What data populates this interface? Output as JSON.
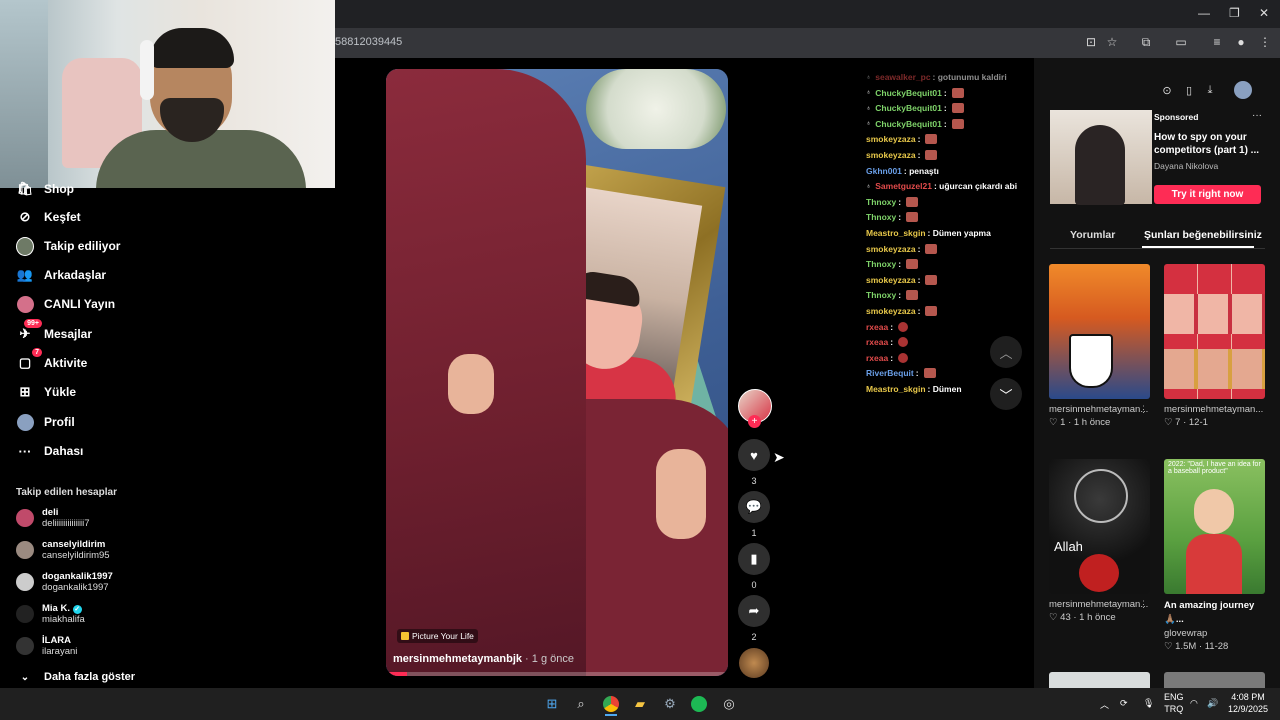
{
  "browser": {
    "url_fragment": "58812039445"
  },
  "sidebar": {
    "items": [
      {
        "label": "Shop",
        "icon": "shop-icon"
      },
      {
        "label": "Keşfet",
        "icon": "compass-icon"
      },
      {
        "label": "Takip ediliyor",
        "icon": "following-icon"
      },
      {
        "label": "Arkadaşlar",
        "icon": "friends-icon"
      },
      {
        "label": "CANLI Yayın",
        "icon": "live-icon"
      },
      {
        "label": "Mesajlar",
        "icon": "messages-icon",
        "badge": "99+"
      },
      {
        "label": "Aktivite",
        "icon": "activity-icon",
        "badge": "7"
      },
      {
        "label": "Yükle",
        "icon": "upload-icon"
      },
      {
        "label": "Profil",
        "icon": "profile-icon"
      },
      {
        "label": "Dahası",
        "icon": "more-icon"
      }
    ],
    "following_header": "Takip edilen hesaplar",
    "accounts": [
      {
        "name": "deli",
        "handle": "deliiiiiiiiiiiiii7"
      },
      {
        "name": "canselyildirim",
        "handle": "canselyildirim95"
      },
      {
        "name": "dogankalik1997",
        "handle": "dogankalik1997"
      },
      {
        "name": "Mia K.",
        "handle": "miakhalifa",
        "verified": true
      },
      {
        "name": "İLARA",
        "handle": "ilarayani"
      }
    ],
    "show_more": "Daha fazla göster"
  },
  "video": {
    "tag": "Picture Your Life",
    "author": "mersinmehmetaymanbjk",
    "time": " · 1 g önce",
    "progress": 0.06,
    "likes": "3",
    "comments": "1",
    "saves": "0",
    "shares": "2"
  },
  "chat": [
    {
      "user": "seawalker_pc",
      "msg": "gotunumu kaldiri",
      "color": "#e24b4b",
      "faded": true
    },
    {
      "user": "ChuckyBequit01",
      "msg": "",
      "color": "#7fd36a",
      "emote": true
    },
    {
      "user": "ChuckyBequit01",
      "msg": "",
      "color": "#7fd36a",
      "emote": true
    },
    {
      "user": "ChuckyBequit01",
      "msg": "",
      "color": "#7fd36a",
      "emote": true
    },
    {
      "user": "smokeyzaza",
      "msg": "",
      "color": "#e8c84a",
      "emote": true
    },
    {
      "user": "smokeyzaza",
      "msg": "",
      "color": "#e8c84a",
      "emote": true
    },
    {
      "user": "Gkhn001",
      "msg": "penaştı",
      "color": "#6a9fe8"
    },
    {
      "user": "Sametguzel21",
      "msg": "uğurcan çıkardı abi",
      "color": "#e24b4b"
    },
    {
      "user": "Thnoxy",
      "msg": "",
      "color": "#7fd36a",
      "emote": true
    },
    {
      "user": "Thnoxy",
      "msg": "",
      "color": "#7fd36a",
      "emote": true
    },
    {
      "user": "Meastro_skgin",
      "msg": "Dümen yapma",
      "color": "#e8c84a"
    },
    {
      "user": "smokeyzaza",
      "msg": "",
      "color": "#e8c84a",
      "emote": true
    },
    {
      "user": "Thnoxy",
      "msg": "",
      "color": "#7fd36a",
      "emote": true
    },
    {
      "user": "smokeyzaza",
      "msg": "",
      "color": "#e8c84a",
      "emote": true
    },
    {
      "user": "Thnoxy",
      "msg": "",
      "color": "#7fd36a",
      "emote": true
    },
    {
      "user": "smokeyzaza",
      "msg": "",
      "color": "#e8c84a",
      "emote": true
    },
    {
      "user": "rxeaa",
      "msg": "",
      "color": "#e24b4b",
      "emote": "round"
    },
    {
      "user": "rxeaa",
      "msg": "",
      "color": "#e24b4b",
      "emote": "round"
    },
    {
      "user": "rxeaa",
      "msg": "",
      "color": "#e24b4b",
      "emote": "round"
    },
    {
      "user": "RiverBequit",
      "msg": "",
      "color": "#6a9fe8",
      "emote": true
    },
    {
      "user": "Meastro_skgin",
      "msg": "Dümen",
      "color": "#e8c84a"
    }
  ],
  "ad": {
    "sponsored": "Sponsored",
    "title": "How to spy on your competitors (part 1) ...",
    "author": "Dayana Nikolova",
    "cta": "Try it right now"
  },
  "right_tabs": {
    "comments": "Yorumlar",
    "liked": "Şunları beğenebilirsiniz"
  },
  "cards": [
    {
      "title": "mersinmehmetayman...",
      "stats": "♡ 1 · 1 h önce",
      "colors": [
        "#f08a2a",
        "#2a4a8a"
      ],
      "label": ""
    },
    {
      "title": "mersinmehmetayman...",
      "stats": "♡ 7 · 12-1",
      "colors": [
        "#d43040",
        "#f0b6a6"
      ],
      "label": ""
    },
    {
      "title": "mersinmehmetayman...",
      "stats": "♡ 43 · 1 h önce",
      "colors": [
        "#1a1a1a",
        "#c02020"
      ],
      "label": "Allah"
    },
    {
      "title": "An amazing journey 🙏🏽...",
      "author": "glovewrap",
      "stats": "♡ 1.5M · 11-28",
      "colors": [
        "#5aa040",
        "#d83a3a"
      ],
      "label": "2022: \"Dad, I have an idea for a baseball product\""
    }
  ],
  "taskbar": {
    "lang": "ENG",
    "lang2": "TRQ",
    "time": "4:08 PM",
    "date": "12/9/2025"
  }
}
